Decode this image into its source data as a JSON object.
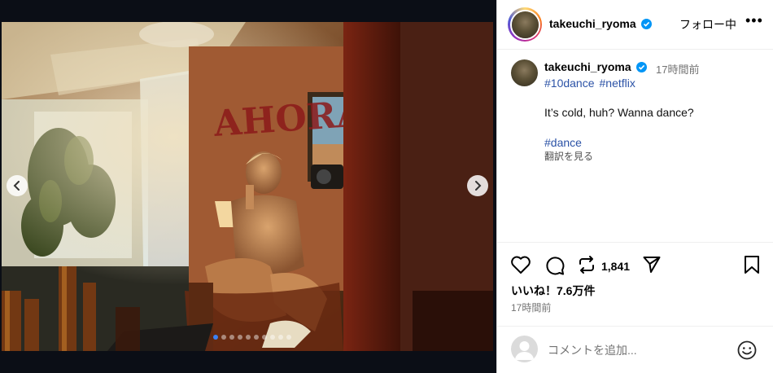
{
  "post": {
    "username": "takeuchi_ryoma",
    "follow_label": "フォロー中",
    "more_label": "•••",
    "caption": {
      "time_ago": "17時間前",
      "hashtags": [
        "#10dance",
        "#netflix"
      ],
      "text": "It’s cold, huh? Wanna dance?",
      "hashtag_end": "#dance",
      "translate_label": "翻訳を見る"
    },
    "stats": {
      "repost_count": "1,841",
      "likes": "いいね！7.6万件",
      "post_time": "17時間前"
    },
    "comment": {
      "placeholder": "コメントを追加..."
    }
  },
  "media": {
    "wall_text": "AHORA",
    "carousel": {
      "total": 10,
      "active_index": 0
    }
  },
  "icons": {
    "verified": "verified-badge-icon",
    "like": "heart-icon",
    "comment": "comment-icon",
    "repost": "repost-icon",
    "share": "share-icon",
    "save": "bookmark-icon",
    "emoji": "emoji-icon",
    "prev": "chevron-left-icon",
    "next": "chevron-right-icon"
  },
  "colors": {
    "link": "#2b52a6",
    "verified": "#0095f6",
    "muted": "#737373"
  }
}
